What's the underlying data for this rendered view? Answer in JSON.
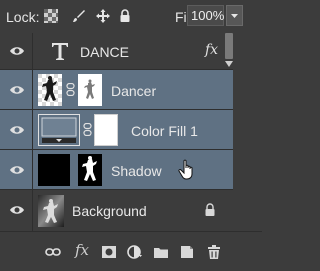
{
  "lock": {
    "label": "Lock:",
    "icons": [
      "lock-transparent-pixels-icon",
      "lock-image-pixels-icon",
      "lock-position-icon",
      "lock-all-icon"
    ]
  },
  "fill": {
    "label": "Fill:",
    "value": "100%"
  },
  "layers": [
    {
      "name": "DANCE",
      "type": "text",
      "visible": true,
      "selected": false,
      "has_fx": true,
      "fx_label": "fx"
    },
    {
      "name": "Dancer",
      "type": "image-with-mask",
      "visible": true,
      "selected": true
    },
    {
      "name": "Color Fill 1",
      "type": "fill-with-mask",
      "visible": true,
      "selected": true
    },
    {
      "name": "Shadow",
      "type": "image-with-mask",
      "visible": true,
      "selected": true
    },
    {
      "name": "Background",
      "type": "background",
      "visible": true,
      "selected": false,
      "locked": true
    }
  ],
  "bottom_icons": [
    "link-layers-icon",
    "layer-style-fx-icon",
    "add-mask-icon",
    "adjustment-layer-icon",
    "new-group-icon",
    "new-layer-icon",
    "delete-layer-icon"
  ],
  "colors": {
    "panel_bg": "#3c3c3c",
    "selected_row": "#5f7183",
    "divider": "#2e2e2e"
  }
}
